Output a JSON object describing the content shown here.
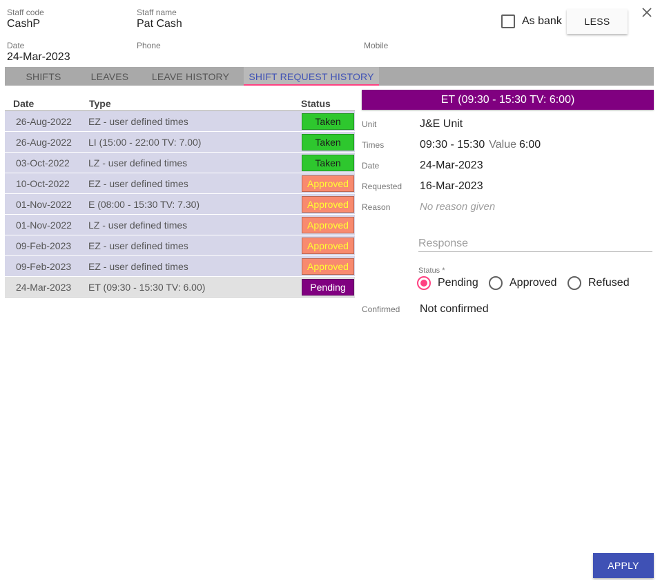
{
  "header": {
    "staff_code_label": "Staff code",
    "staff_code": "CashP",
    "staff_name_label": "Staff name",
    "staff_name": "Pat Cash",
    "date_label": "Date",
    "date": "24-Mar-2023",
    "phone_label": "Phone",
    "phone": "",
    "mobile_label": "Mobile",
    "mobile": "",
    "as_bank_label": "As bank",
    "as_bank_checked": false,
    "less_label": "LESS",
    "close_icon": "close-icon"
  },
  "tabs": [
    {
      "label": "SHIFTS",
      "active": false
    },
    {
      "label": "LEAVES",
      "active": false
    },
    {
      "label": "LEAVE HISTORY",
      "active": false
    },
    {
      "label": "SHIFT REQUEST HISTORY",
      "active": true
    }
  ],
  "list": {
    "columns": [
      "Date",
      "Type",
      "Status"
    ],
    "rows": [
      {
        "date": "26-Aug-2022",
        "type": "EZ - user defined times",
        "status": "Taken"
      },
      {
        "date": "26-Aug-2022",
        "type": "LI (15:00 - 22:00 TV: 7.00)",
        "status": "Taken"
      },
      {
        "date": "03-Oct-2022",
        "type": "LZ - user defined times",
        "status": "Taken"
      },
      {
        "date": "10-Oct-2022",
        "type": "EZ - user defined times",
        "status": "Approved"
      },
      {
        "date": "01-Nov-2022",
        "type": "E (08:00 - 15:30 TV: 7.30)",
        "status": "Approved"
      },
      {
        "date": "01-Nov-2022",
        "type": "LZ - user defined times",
        "status": "Approved"
      },
      {
        "date": "09-Feb-2023",
        "type": "EZ - user defined times",
        "status": "Approved"
      },
      {
        "date": "09-Feb-2023",
        "type": "EZ - user defined times",
        "status": "Approved"
      },
      {
        "date": "24-Mar-2023",
        "type": "ET (09:30 - 15:30 TV: 6.00)",
        "status": "Pending",
        "selected": true
      }
    ]
  },
  "status_colors": {
    "Taken": {
      "bg": "#2ec72e",
      "fg": "#1b1b1b"
    },
    "Approved": {
      "bg": "#f88a6f",
      "fg": "#ffff33"
    },
    "Pending": {
      "bg": "#800080",
      "fg": "#ffffff"
    }
  },
  "detail": {
    "title": "ET (09:30 - 15:30 TV: 6:00)",
    "unit_label": "Unit",
    "unit": "J&E Unit",
    "times_label": "Times",
    "times": "09:30 - 15:30",
    "value_label": "Value",
    "value": "6:00",
    "date_label": "Date",
    "date": "24-Mar-2023",
    "requested_label": "Requested",
    "requested": "16-Mar-2023",
    "reason_label": "Reason",
    "reason": "No reason given",
    "response_placeholder": "Response",
    "status_label": "Status *",
    "status_options": [
      "Pending",
      "Approved",
      "Refused"
    ],
    "status_selected": "Pending",
    "confirmed_label": "Confirmed",
    "confirmed": "Not confirmed"
  },
  "footer": {
    "apply_label": "APPLY"
  }
}
